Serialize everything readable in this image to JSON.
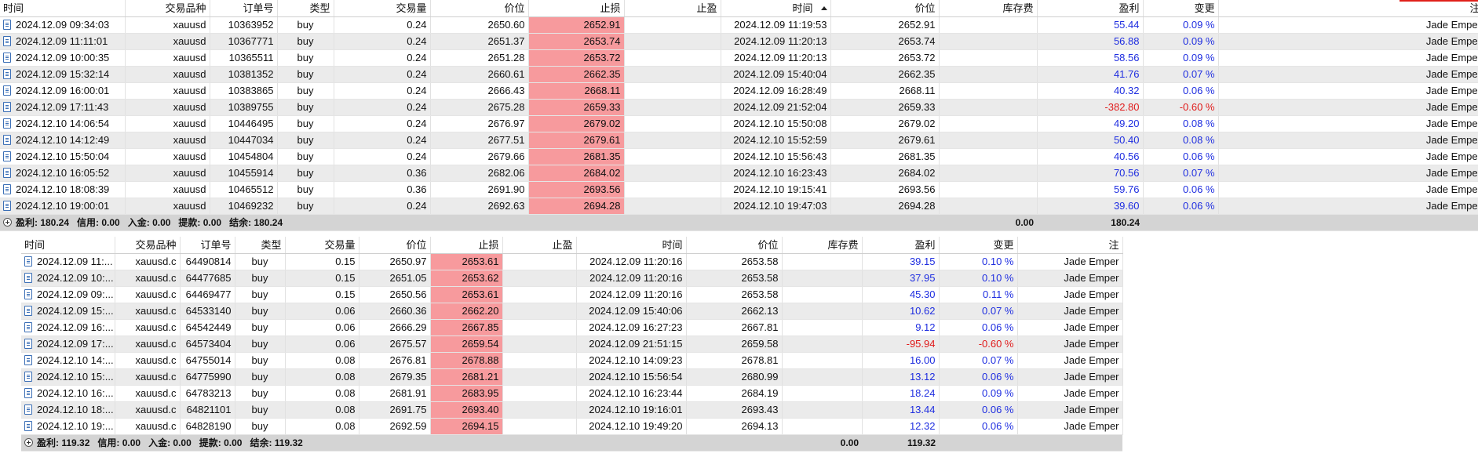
{
  "top": {
    "headers": {
      "time": "时间",
      "symbol": "交易品种",
      "order": "订单号",
      "type": "类型",
      "volume": "交易量",
      "price": "价位",
      "sl": "止损",
      "tp": "止盈",
      "close_time": "时间",
      "close_price": "价位",
      "swap": "库存费",
      "profit": "盈利",
      "change": "变更",
      "comment": "注释"
    },
    "rows": [
      {
        "time": "2024.12.09 09:34:03",
        "symbol": "xauusd",
        "order": "10363952",
        "type": "buy",
        "volume": "0.24",
        "price": "2650.60",
        "sl": "2652.91",
        "tp": "",
        "close_time": "2024.12.09 11:19:53",
        "close_price": "2652.91",
        "swap": "",
        "profit": "55.44",
        "change": "0.09 %",
        "comment": "Jade Emperor"
      },
      {
        "time": "2024.12.09 11:11:01",
        "symbol": "xauusd",
        "order": "10367771",
        "type": "buy",
        "volume": "0.24",
        "price": "2651.37",
        "sl": "2653.74",
        "tp": "",
        "close_time": "2024.12.09 11:20:13",
        "close_price": "2653.74",
        "swap": "",
        "profit": "56.88",
        "change": "0.09 %",
        "comment": "Jade Emperor"
      },
      {
        "time": "2024.12.09 10:00:35",
        "symbol": "xauusd",
        "order": "10365511",
        "type": "buy",
        "volume": "0.24",
        "price": "2651.28",
        "sl": "2653.72",
        "tp": "",
        "close_time": "2024.12.09 11:20:13",
        "close_price": "2653.72",
        "swap": "",
        "profit": "58.56",
        "change": "0.09 %",
        "comment": "Jade Emperor"
      },
      {
        "time": "2024.12.09 15:32:14",
        "symbol": "xauusd",
        "order": "10381352",
        "type": "buy",
        "volume": "0.24",
        "price": "2660.61",
        "sl": "2662.35",
        "tp": "",
        "close_time": "2024.12.09 15:40:04",
        "close_price": "2662.35",
        "swap": "",
        "profit": "41.76",
        "change": "0.07 %",
        "comment": "Jade Emperor"
      },
      {
        "time": "2024.12.09 16:00:01",
        "symbol": "xauusd",
        "order": "10383865",
        "type": "buy",
        "volume": "0.24",
        "price": "2666.43",
        "sl": "2668.11",
        "tp": "",
        "close_time": "2024.12.09 16:28:49",
        "close_price": "2668.11",
        "swap": "",
        "profit": "40.32",
        "change": "0.06 %",
        "comment": "Jade Emperor"
      },
      {
        "time": "2024.12.09 17:11:43",
        "symbol": "xauusd",
        "order": "10389755",
        "type": "buy",
        "volume": "0.24",
        "price": "2675.28",
        "sl": "2659.33",
        "tp": "",
        "close_time": "2024.12.09 21:52:04",
        "close_price": "2659.33",
        "swap": "",
        "profit": "-382.80",
        "change": "-0.60 %",
        "comment": "Jade Emperor",
        "negative": true
      },
      {
        "time": "2024.12.10 14:06:54",
        "symbol": "xauusd",
        "order": "10446495",
        "type": "buy",
        "volume": "0.24",
        "price": "2676.97",
        "sl": "2679.02",
        "tp": "",
        "close_time": "2024.12.10 15:50:08",
        "close_price": "2679.02",
        "swap": "",
        "profit": "49.20",
        "change": "0.08 %",
        "comment": "Jade Emperor"
      },
      {
        "time": "2024.12.10 14:12:49",
        "symbol": "xauusd",
        "order": "10447034",
        "type": "buy",
        "volume": "0.24",
        "price": "2677.51",
        "sl": "2679.61",
        "tp": "",
        "close_time": "2024.12.10 15:52:59",
        "close_price": "2679.61",
        "swap": "",
        "profit": "50.40",
        "change": "0.08 %",
        "comment": "Jade Emperor"
      },
      {
        "time": "2024.12.10 15:50:04",
        "symbol": "xauusd",
        "order": "10454804",
        "type": "buy",
        "volume": "0.24",
        "price": "2679.66",
        "sl": "2681.35",
        "tp": "",
        "close_time": "2024.12.10 15:56:43",
        "close_price": "2681.35",
        "swap": "",
        "profit": "40.56",
        "change": "0.06 %",
        "comment": "Jade Emperor"
      },
      {
        "time": "2024.12.10 16:05:52",
        "symbol": "xauusd",
        "order": "10455914",
        "type": "buy",
        "volume": "0.36",
        "price": "2682.06",
        "sl": "2684.02",
        "tp": "",
        "close_time": "2024.12.10 16:23:43",
        "close_price": "2684.02",
        "swap": "",
        "profit": "70.56",
        "change": "0.07 %",
        "comment": "Jade Emperor"
      },
      {
        "time": "2024.12.10 18:08:39",
        "symbol": "xauusd",
        "order": "10465512",
        "type": "buy",
        "volume": "0.36",
        "price": "2691.90",
        "sl": "2693.56",
        "tp": "",
        "close_time": "2024.12.10 19:15:41",
        "close_price": "2693.56",
        "swap": "",
        "profit": "59.76",
        "change": "0.06 %",
        "comment": "Jade Emperor"
      },
      {
        "time": "2024.12.10 19:00:01",
        "symbol": "xauusd",
        "order": "10469232",
        "type": "buy",
        "volume": "0.24",
        "price": "2692.63",
        "sl": "2694.28",
        "tp": "",
        "close_time": "2024.12.10 19:47:03",
        "close_price": "2694.28",
        "swap": "",
        "profit": "39.60",
        "change": "0.06 %",
        "comment": "Jade Emperor"
      }
    ],
    "summary": {
      "profit": "盈利: 180.24",
      "credit": "信用: 0.00",
      "deposit": "入金: 0.00",
      "withdraw": "提款: 0.00",
      "balance": "结余: 180.24",
      "swap_total": "0.00",
      "profit_total": "180.24"
    }
  },
  "bottom": {
    "headers": {
      "time": "时间",
      "symbol": "交易品种",
      "order": "订单号",
      "type": "类型",
      "volume": "交易量",
      "price": "价位",
      "sl": "止损",
      "tp": "止盈",
      "close_time": "时间",
      "close_price": "价位",
      "swap": "库存费",
      "profit": "盈利",
      "change": "变更",
      "comment": "注"
    },
    "rows": [
      {
        "time": "2024.12.09 11:...",
        "symbol": "xauusd.c",
        "order": "64490814",
        "type": "buy",
        "volume": "0.15",
        "price": "2650.97",
        "sl": "2653.61",
        "tp": "",
        "close_time": "2024.12.09 11:20:16",
        "close_price": "2653.58",
        "swap": "",
        "profit": "39.15",
        "change": "0.10 %",
        "comment": "Jade Emper"
      },
      {
        "time": "2024.12.09 10:...",
        "symbol": "xauusd.c",
        "order": "64477685",
        "type": "buy",
        "volume": "0.15",
        "price": "2651.05",
        "sl": "2653.62",
        "tp": "",
        "close_time": "2024.12.09 11:20:16",
        "close_price": "2653.58",
        "swap": "",
        "profit": "37.95",
        "change": "0.10 %",
        "comment": "Jade Emper"
      },
      {
        "time": "2024.12.09 09:...",
        "symbol": "xauusd.c",
        "order": "64469477",
        "type": "buy",
        "volume": "0.15",
        "price": "2650.56",
        "sl": "2653.61",
        "tp": "",
        "close_time": "2024.12.09 11:20:16",
        "close_price": "2653.58",
        "swap": "",
        "profit": "45.30",
        "change": "0.11 %",
        "comment": "Jade Emper"
      },
      {
        "time": "2024.12.09 15:...",
        "symbol": "xauusd.c",
        "order": "64533140",
        "type": "buy",
        "volume": "0.06",
        "price": "2660.36",
        "sl": "2662.20",
        "tp": "",
        "close_time": "2024.12.09 15:40:06",
        "close_price": "2662.13",
        "swap": "",
        "profit": "10.62",
        "change": "0.07 %",
        "comment": "Jade Emper"
      },
      {
        "time": "2024.12.09 16:...",
        "symbol": "xauusd.c",
        "order": "64542449",
        "type": "buy",
        "volume": "0.06",
        "price": "2666.29",
        "sl": "2667.85",
        "tp": "",
        "close_time": "2024.12.09 16:27:23",
        "close_price": "2667.81",
        "swap": "",
        "profit": "9.12",
        "change": "0.06 %",
        "comment": "Jade Emper"
      },
      {
        "time": "2024.12.09 17:...",
        "symbol": "xauusd.c",
        "order": "64573404",
        "type": "buy",
        "volume": "0.06",
        "price": "2675.57",
        "sl": "2659.54",
        "tp": "",
        "close_time": "2024.12.09 21:51:15",
        "close_price": "2659.58",
        "swap": "",
        "profit": "-95.94",
        "change": "-0.60 %",
        "comment": "Jade Emper",
        "negative": true
      },
      {
        "time": "2024.12.10 14:...",
        "symbol": "xauusd.c",
        "order": "64755014",
        "type": "buy",
        "volume": "0.08",
        "price": "2676.81",
        "sl": "2678.88",
        "tp": "",
        "close_time": "2024.12.10 14:09:23",
        "close_price": "2678.81",
        "swap": "",
        "profit": "16.00",
        "change": "0.07 %",
        "comment": "Jade Emper"
      },
      {
        "time": "2024.12.10 15:...",
        "symbol": "xauusd.c",
        "order": "64775990",
        "type": "buy",
        "volume": "0.08",
        "price": "2679.35",
        "sl": "2681.21",
        "tp": "",
        "close_time": "2024.12.10 15:56:54",
        "close_price": "2680.99",
        "swap": "",
        "profit": "13.12",
        "change": "0.06 %",
        "comment": "Jade Emper"
      },
      {
        "time": "2024.12.10 16:...",
        "symbol": "xauusd.c",
        "order": "64783213",
        "type": "buy",
        "volume": "0.08",
        "price": "2681.91",
        "sl": "2683.95",
        "tp": "",
        "close_time": "2024.12.10 16:23:44",
        "close_price": "2684.19",
        "swap": "",
        "profit": "18.24",
        "change": "0.09 %",
        "comment": "Jade Emper"
      },
      {
        "time": "2024.12.10 18:...",
        "symbol": "xauusd.c",
        "order": "64821101",
        "type": "buy",
        "volume": "0.08",
        "price": "2691.75",
        "sl": "2693.40",
        "tp": "",
        "close_time": "2024.12.10 19:16:01",
        "close_price": "2693.43",
        "swap": "",
        "profit": "13.44",
        "change": "0.06 %",
        "comment": "Jade Emper"
      },
      {
        "time": "2024.12.10 19:...",
        "symbol": "xauusd.c",
        "order": "64828190",
        "type": "buy",
        "volume": "0.08",
        "price": "2692.59",
        "sl": "2694.15",
        "tp": "",
        "close_time": "2024.12.10 19:49:20",
        "close_price": "2694.13",
        "swap": "",
        "profit": "12.32",
        "change": "0.06 %",
        "comment": "Jade Emper"
      }
    ],
    "summary": {
      "profit": "盈利: 119.32",
      "credit": "信用: 0.00",
      "deposit": "入金: 0.00",
      "withdraw": "提款: 0.00",
      "balance": "结余: 119.32",
      "swap_total": "0.00",
      "profit_total": "119.32"
    }
  },
  "colors": {
    "stop_loss_bg": "#f79a9d",
    "positive_profit": "#1f2ee0",
    "negative_profit": "#e01a1a",
    "alt_row": "#ebebeb",
    "summary_bg": "#d4d4d4",
    "accent_marker": "#e0201a"
  },
  "icons": {
    "row_icon": "document-icon",
    "sort_icon": "sort-ascending-icon",
    "summary_icon": "expand-plus-icon"
  }
}
